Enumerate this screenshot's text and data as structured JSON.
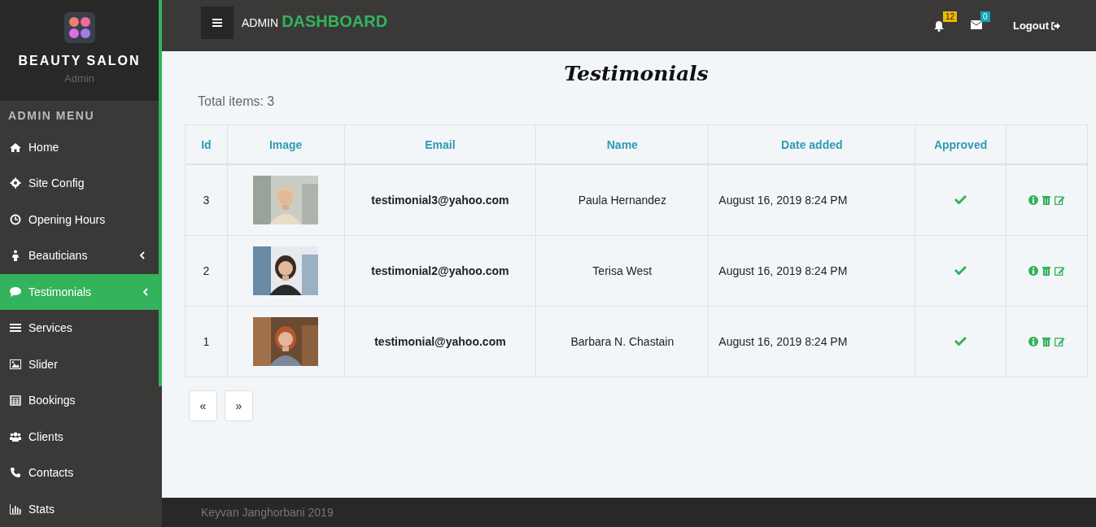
{
  "brand": {
    "title": "BEAUTY SALON",
    "subtitle": "Admin"
  },
  "sidebar": {
    "heading": "ADMIN MENU",
    "items": [
      {
        "label": "Home",
        "selected": false,
        "submenu": false
      },
      {
        "label": "Site Config",
        "selected": false,
        "submenu": false
      },
      {
        "label": "Opening Hours",
        "selected": false,
        "submenu": false
      },
      {
        "label": "Beauticians",
        "selected": false,
        "submenu": true
      },
      {
        "label": "Testimonials",
        "selected": true,
        "submenu": true
      },
      {
        "label": "Services",
        "selected": false,
        "submenu": false
      },
      {
        "label": "Slider",
        "selected": false,
        "submenu": false
      },
      {
        "label": "Bookings",
        "selected": false,
        "submenu": false
      },
      {
        "label": "Clients",
        "selected": false,
        "submenu": false
      },
      {
        "label": "Contacts",
        "selected": false,
        "submenu": false
      },
      {
        "label": "Stats",
        "selected": false,
        "submenu": false
      }
    ]
  },
  "topbar": {
    "title_prefix": "ADMIN",
    "title": "DASHBOARD",
    "notifications": "12",
    "messages": "0",
    "logout": "Logout"
  },
  "page": {
    "title": "Testimonials",
    "total": "Total items: 3"
  },
  "table": {
    "columns": [
      "Id",
      "Image",
      "Email",
      "Name",
      "Date added",
      "Approved"
    ],
    "rows": [
      {
        "id": "3",
        "email": "testimonial3@yahoo.com",
        "name": "Paula Hernandez",
        "date": "August 16, 2019 8:24 PM",
        "approved": true
      },
      {
        "id": "2",
        "email": "testimonial2@yahoo.com",
        "name": "Terisa West",
        "date": "August 16, 2019 8:24 PM",
        "approved": true
      },
      {
        "id": "1",
        "email": "testimonial@yahoo.com",
        "name": "Barbara N. Chastain",
        "date": "August 16, 2019 8:24 PM",
        "approved": true
      }
    ]
  },
  "pagination": [
    "«",
    "»"
  ],
  "footer": "Keyvan Janghorbani 2019"
}
